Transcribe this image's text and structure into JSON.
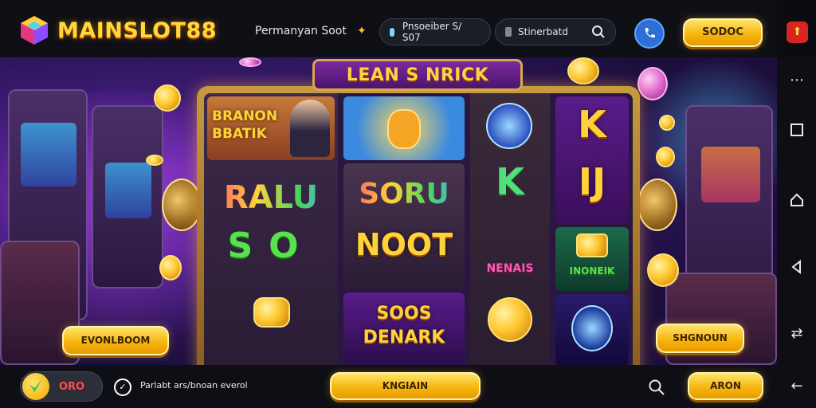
{
  "header": {
    "brand": "MAINSLOT88",
    "nav_link": "Permanyan Soot",
    "pill1": "Pnsoeiber S/ S07",
    "pill2": "Stinerbatd",
    "action_button": "SODOC"
  },
  "game": {
    "banner": "LEAN S NRICK",
    "symbols": {
      "r1_title": "BRANON BBATIK",
      "r1_mid": "RALU",
      "r1_mid2": "SO",
      "r2_mid1": "SORU",
      "r2_mid2": "NOOT",
      "r2_bot1": "SOOS",
      "r2_bot2": "DENARK",
      "r3_mid": "K",
      "r3_mid2": "NENAIS",
      "r4_top": "K",
      "r4_mid": "IJ",
      "r4_mid2": "INONEIK"
    },
    "left_button": "EVONLBOOM",
    "right_button": "SHGNOUN"
  },
  "footer": {
    "balance": "ORO",
    "info_text": "Parlabt ars/bnoan everol",
    "center_button": "KNGIAIN",
    "right_button": "ARON"
  },
  "colors": {
    "gold": "#f6b70f",
    "bar": "#0f0f16",
    "accent_blue": "#2d6fd6",
    "accent_red": "#d6261f"
  }
}
